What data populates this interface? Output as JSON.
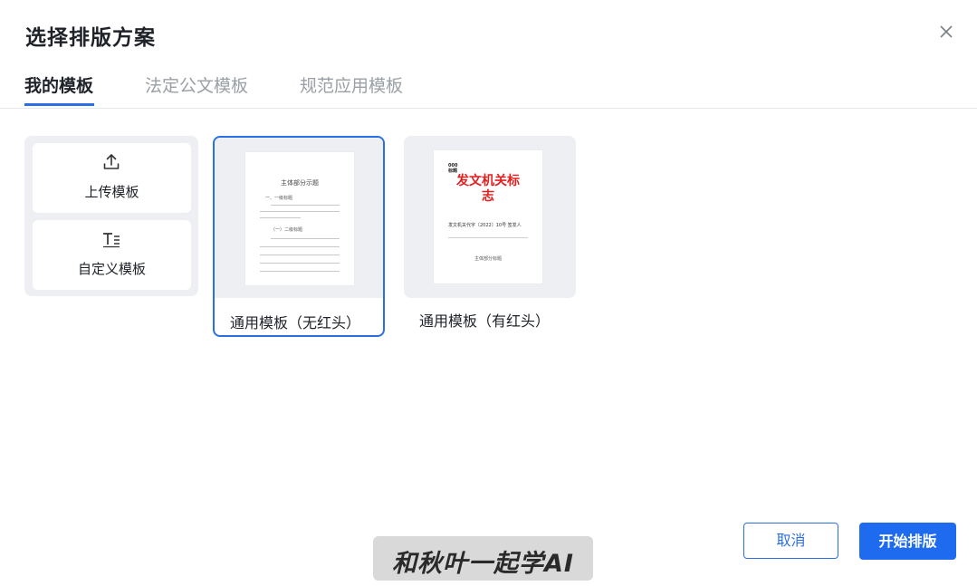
{
  "dialog": {
    "title": "选择排版方案",
    "close_icon": "close-icon"
  },
  "tabs": [
    {
      "label": "我的模板",
      "active": true
    },
    {
      "label": "法定公文模板",
      "active": false
    },
    {
      "label": "规范应用模板",
      "active": false
    }
  ],
  "actions": {
    "upload": {
      "label": "上传模板",
      "icon": "upload-icon"
    },
    "custom": {
      "label": "自定义模板",
      "icon": "text-format-icon"
    }
  },
  "templates": [
    {
      "name": "通用模板（无红头）",
      "selected": true,
      "preview": {
        "title": "主体部分示题",
        "heading1": "一、一级标题",
        "heading2": "（一）二级标题"
      }
    },
    {
      "name": "通用模板（有红头）",
      "selected": false,
      "preview": {
        "corner_text": "000\n标题",
        "red_head": "发文机关标\n志",
        "doc_number": "发文机关代字〔2022〕10号 签发人",
        "subtitle": "主体部分标题"
      }
    }
  ],
  "footer": {
    "cancel_label": "取消",
    "start_label": "开始排版"
  },
  "watermark": {
    "text": "和秋叶一起学AI"
  },
  "colors": {
    "accent": "#1f6bf0",
    "red_head": "#e02020",
    "card_bg": "#eeeff2"
  }
}
